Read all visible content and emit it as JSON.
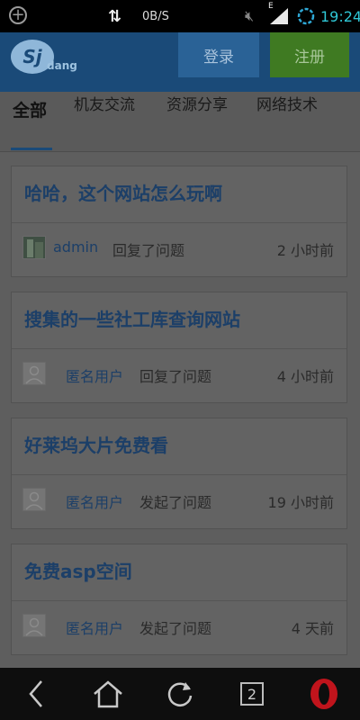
{
  "status_bar": {
    "net_speed": "0B/S",
    "time": "19:24",
    "signal_label": "E"
  },
  "header": {
    "logo_mark": "Sj",
    "logo_text": "dang",
    "login_label": "登录",
    "register_label": "注册"
  },
  "tabs": [
    {
      "label": "全部"
    },
    {
      "label": "机友交流"
    },
    {
      "label": "资源分享"
    },
    {
      "label": "网络技术"
    }
  ],
  "posts": [
    {
      "title": "哈哈，这个网站怎么玩啊",
      "user": "admin",
      "action": "回复了问题",
      "time": "2 小时前",
      "avatar": "photo"
    },
    {
      "title": "搜集的一些社工库查询网站",
      "user": "匿名用户",
      "action": "回复了问题",
      "time": "4 小时前",
      "avatar": "default"
    },
    {
      "title": "好莱坞大片免费看",
      "user": "匿名用户",
      "action": "发起了问题",
      "time": "19 小时前",
      "avatar": "default"
    },
    {
      "title": "免费asp空间",
      "user": "匿名用户",
      "action": "发起了问题",
      "time": "4 天前",
      "avatar": "default"
    }
  ],
  "navbar": {
    "tab_count": "2"
  },
  "colors": {
    "header_bg": "#1a4a78",
    "register_bg": "#3f7a22",
    "time_color": "#2fc7d6",
    "opera_red": "#c0141c"
  }
}
